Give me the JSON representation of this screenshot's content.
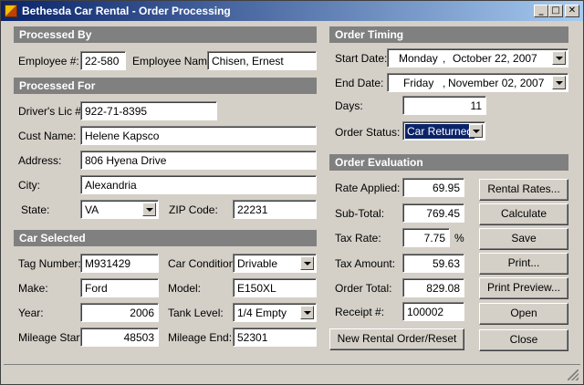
{
  "window": {
    "title": "Bethesda Car Rental - Order Processing",
    "controls": {
      "minimize": "_",
      "maximize": "□",
      "close": "✕"
    }
  },
  "processed_by": {
    "header": "Processed By",
    "employee_num_label": "Employee #:",
    "employee_num": "22-580",
    "employee_name_label": "Employee Name:",
    "employee_name": "Chisen, Ernest"
  },
  "processed_for": {
    "header": "Processed For",
    "drivers_lic_label": "Driver's Lic #:",
    "drivers_lic": "922-71-8395",
    "cust_name_label": "Cust Name:",
    "cust_name": "Helene Kapsco",
    "address_label": "Address:",
    "address": "806 Hyena Drive",
    "city_label": "City:",
    "city": "Alexandria",
    "state_label": "State:",
    "state": "VA",
    "zip_label": "ZIP Code:",
    "zip": "22231"
  },
  "car_selected": {
    "header": "Car Selected",
    "tag_label": "Tag Number:",
    "tag": "M931429",
    "condition_label": "Car Condition:",
    "condition": "Drivable",
    "make_label": "Make:",
    "make": "Ford",
    "model_label": "Model:",
    "model": "E150XL",
    "year_label": "Year:",
    "year": "2006",
    "tank_label": "Tank Level:",
    "tank": "1/4 Empty",
    "mileage_start_label": "Mileage Start:",
    "mileage_start": "48503",
    "mileage_end_label": "Mileage End:",
    "mileage_end": "52301"
  },
  "order_timing": {
    "header": "Order Timing",
    "start_label": "Start Date:",
    "start_day": "Monday",
    "start_date": "October  22, 2007",
    "end_label": "End Date:",
    "end_day": "Friday",
    "end_date": "November 02, 2007",
    "sep": ",",
    "days_label": "Days:",
    "days": "11",
    "status_label": "Order Status:",
    "status": "Car Returned"
  },
  "order_evaluation": {
    "header": "Order Evaluation",
    "rate_label": "Rate Applied:",
    "rate": "69.95",
    "subtotal_label": "Sub-Total:",
    "subtotal": "769.45",
    "taxrate_label": "Tax Rate:",
    "taxrate": "7.75",
    "percent": "%",
    "taxamount_label": "Tax Amount:",
    "taxamount": "59.63",
    "ordertotal_label": "Order Total:",
    "ordertotal": "829.08",
    "receipt_label": "Receipt #:",
    "receipt": "100002"
  },
  "buttons": {
    "rental_rates": "Rental Rates...",
    "calculate": "Calculate",
    "save": "Save",
    "print": "Print...",
    "print_preview": "Print Preview...",
    "open": "Open",
    "close": "Close",
    "new_order": "New Rental Order/Reset"
  }
}
